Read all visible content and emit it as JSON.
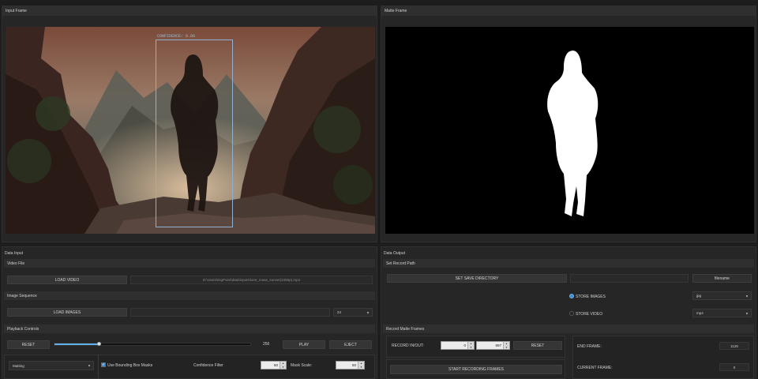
{
  "input_frame": {
    "title": "Input Frame",
    "bbox_label": "CONFIDENCE: 0.86"
  },
  "matte_frame": {
    "title": "Matte Frame"
  },
  "data_input": {
    "title": "Data Input",
    "video_file": {
      "title": "Video File",
      "load_label": "LOAD VIDEO",
      "path": "D:\\VanishingPoint\\data\\inputs\\lone_maas_sunset(1080p).mp4"
    },
    "image_sequence": {
      "title": "Image Sequence",
      "load_label": "LOAD IMAGES",
      "path": "",
      "fps_value": "24"
    },
    "playback": {
      "title": "Playback Controls",
      "reset_label": "RESET",
      "slider_fraction": 0.23,
      "frame_value": "256",
      "play_label": "PLAY",
      "eject_label": "EJECT",
      "mode_value": "Matting",
      "use_bbox_label": "Use Bounding Box Masks",
      "use_bbox_checked": true,
      "confidence_label": "Confidence Filter",
      "confidence_value": "50",
      "mask_scale_label": "Mask Scale:",
      "mask_scale_value": "50"
    }
  },
  "data_output": {
    "title": "Data Output",
    "record_path": {
      "title": "Set Record Path",
      "set_dir_label": "SET SAVE DIRECTORY",
      "dir_value": "",
      "filename_label": "filename",
      "store_images_label": "STORE IMAGES",
      "store_images_on": true,
      "images_format": "jpg",
      "store_video_label": "STORE VIDEO",
      "store_video_on": false,
      "video_format": "mp4"
    },
    "record_frames": {
      "title": "Record Matte Frames",
      "inout_label": "RECORD IN/OUT:",
      "in_value": "0",
      "out_value": "897",
      "reset_label": "RESET",
      "start_label": "START RECORDING FRAMES",
      "end_frame_label": "END FRAME:",
      "end_frame_value": "1126",
      "current_frame_label": "CURRENT FRAME:",
      "current_frame_value": "0"
    }
  },
  "colors": {
    "accent": "#3a8fd8",
    "slider": "#5fb0e8"
  }
}
